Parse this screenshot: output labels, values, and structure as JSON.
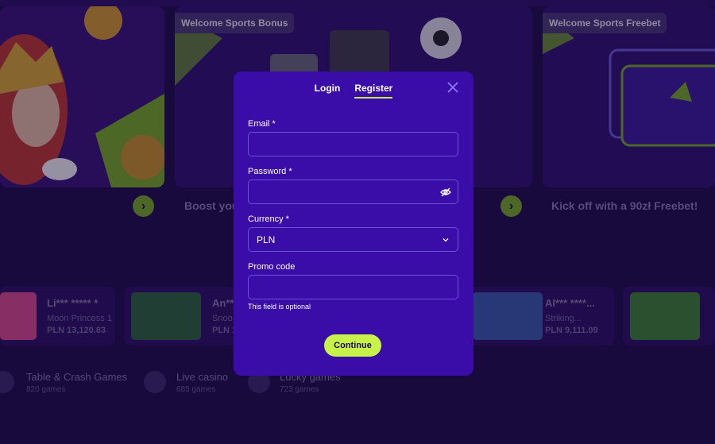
{
  "promos": [
    {
      "tag": "",
      "caption": ""
    },
    {
      "tag": "Welcome Sports Bonus",
      "caption": "Boost you"
    },
    {
      "tag": "Welcome Sports Freebet",
      "caption": "Kick off with a 90zł Freebet!"
    }
  ],
  "winners": [
    {
      "name": "Li*** ***** *",
      "game": "Moon Princess 1",
      "amount": "PLN 13,120.83"
    },
    {
      "name": "An***",
      "game": "Snoo",
      "amount": "PLN 1"
    },
    {
      "name": "Al*** ****...",
      "game": "Striking...",
      "amount": "PLN 9,111.09"
    }
  ],
  "categories": [
    {
      "title": "Table & Crash Games",
      "count": "820 games",
      "icon": "cards-icon"
    },
    {
      "title": "Live casino",
      "count": "685 games",
      "icon": "chip-icon"
    },
    {
      "title": "Lucky games",
      "count": "723 games",
      "icon": "clover-icon"
    }
  ],
  "modal": {
    "tabs": [
      "Login",
      "Register"
    ],
    "active_tab": "Register",
    "email_label": "Email *",
    "email_value": "",
    "password_label": "Password *",
    "password_value": "",
    "currency_label": "Currency *",
    "currency_value": "PLN",
    "promo_label": "Promo code",
    "promo_value": "",
    "promo_hint": "This field is optional",
    "continue_label": "Continue"
  },
  "colors": {
    "background": "#1e0b4a",
    "modal": "#3a0ca8",
    "accent": "#c7f24a",
    "arrow": "#7cb51f"
  }
}
